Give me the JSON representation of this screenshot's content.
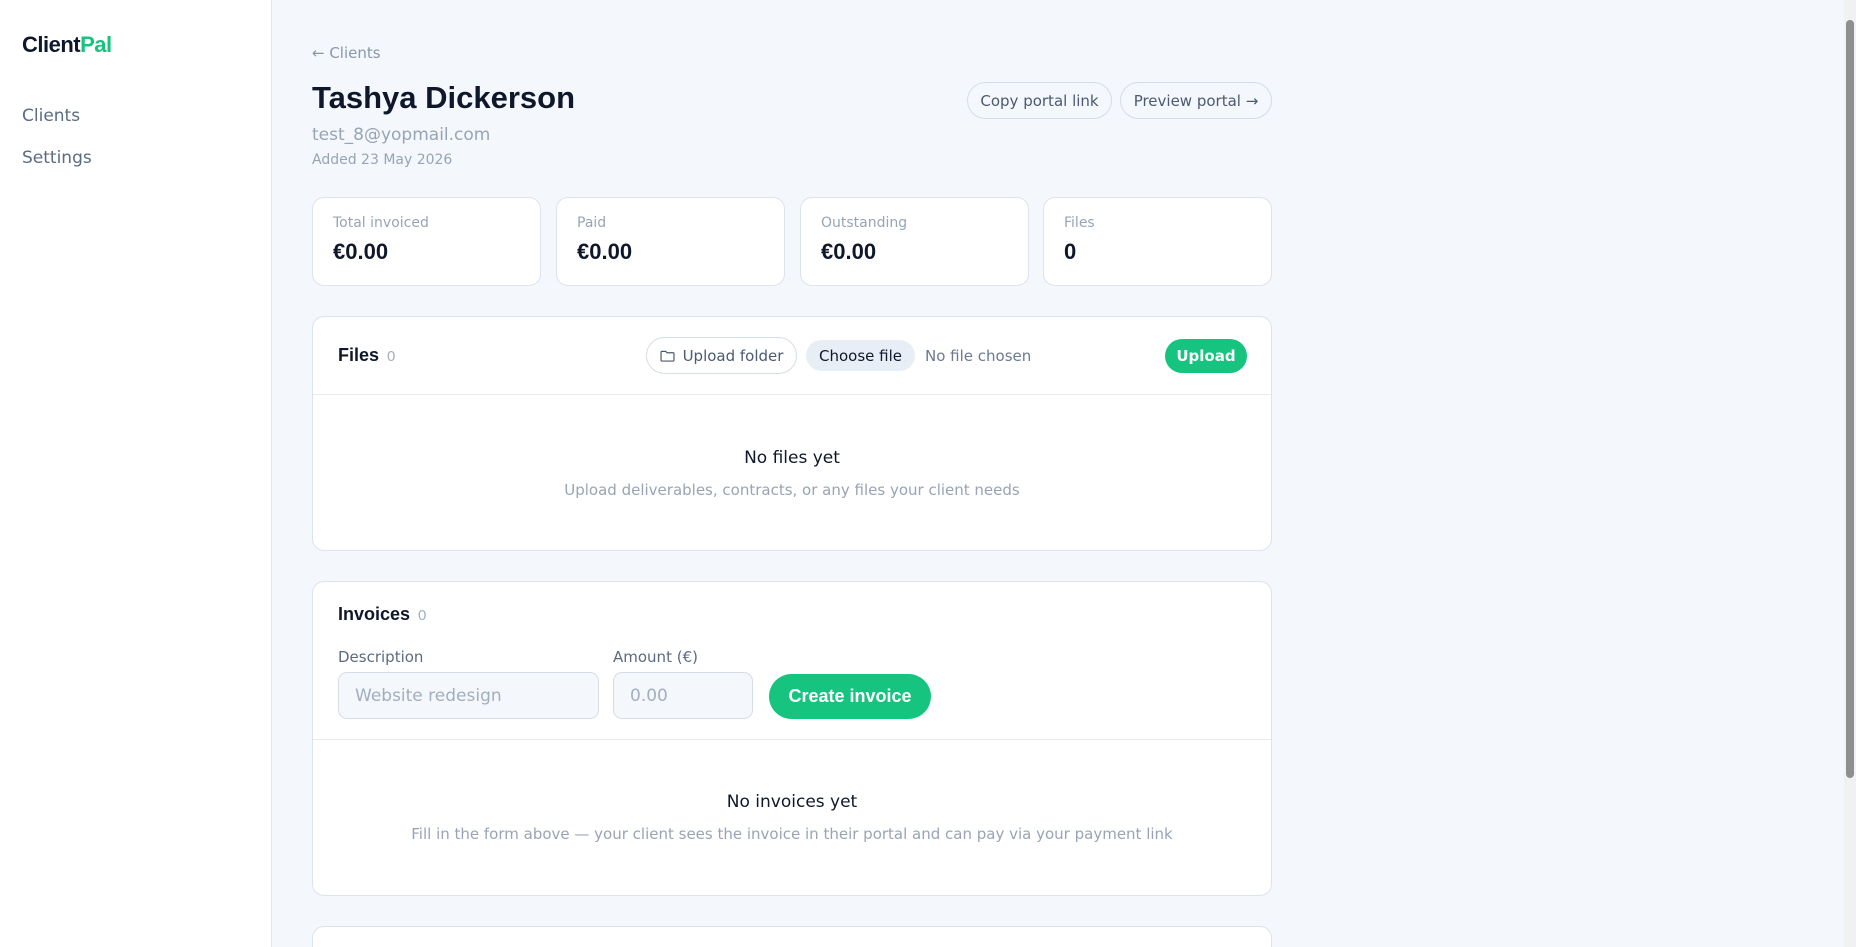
{
  "app": {
    "logo_main": "Client",
    "logo_accent": "Pal"
  },
  "sidebar": {
    "items": [
      {
        "label": "Clients"
      },
      {
        "label": "Settings"
      }
    ]
  },
  "header": {
    "back_label": "← Clients",
    "client_name": "Tashya Dickerson",
    "email": "test_8@yopmail.com",
    "added": "Added 23 May 2026",
    "copy_link_label": "Copy portal link",
    "preview_label": "Preview portal →"
  },
  "stats": [
    {
      "label": "Total invoiced",
      "value": "€0.00"
    },
    {
      "label": "Paid",
      "value": "€0.00"
    },
    {
      "label": "Outstanding",
      "value": "€0.00"
    },
    {
      "label": "Files",
      "value": "0"
    }
  ],
  "files": {
    "title": "Files",
    "count": "0",
    "upload_folder_label": "Upload folder",
    "choose_file_label": "Choose file",
    "no_file_text": "No file chosen",
    "upload_label": "Upload",
    "empty_title": "No files yet",
    "empty_subtitle": "Upload deliverables, contracts, or any files your client needs"
  },
  "invoices": {
    "title": "Invoices",
    "count": "0",
    "description_label": "Description",
    "description_placeholder": "Website redesign",
    "amount_label": "Amount (€)",
    "amount_placeholder": "0.00",
    "create_label": "Create invoice",
    "empty_title": "No invoices yet",
    "empty_subtitle": "Fill in the form above — your client sees the invoice in their portal and can pay via your payment link"
  },
  "colors": {
    "accent": "#16c47f",
    "background": "#f4f7fc",
    "text": "#0f172a",
    "muted": "#98a4b5"
  }
}
